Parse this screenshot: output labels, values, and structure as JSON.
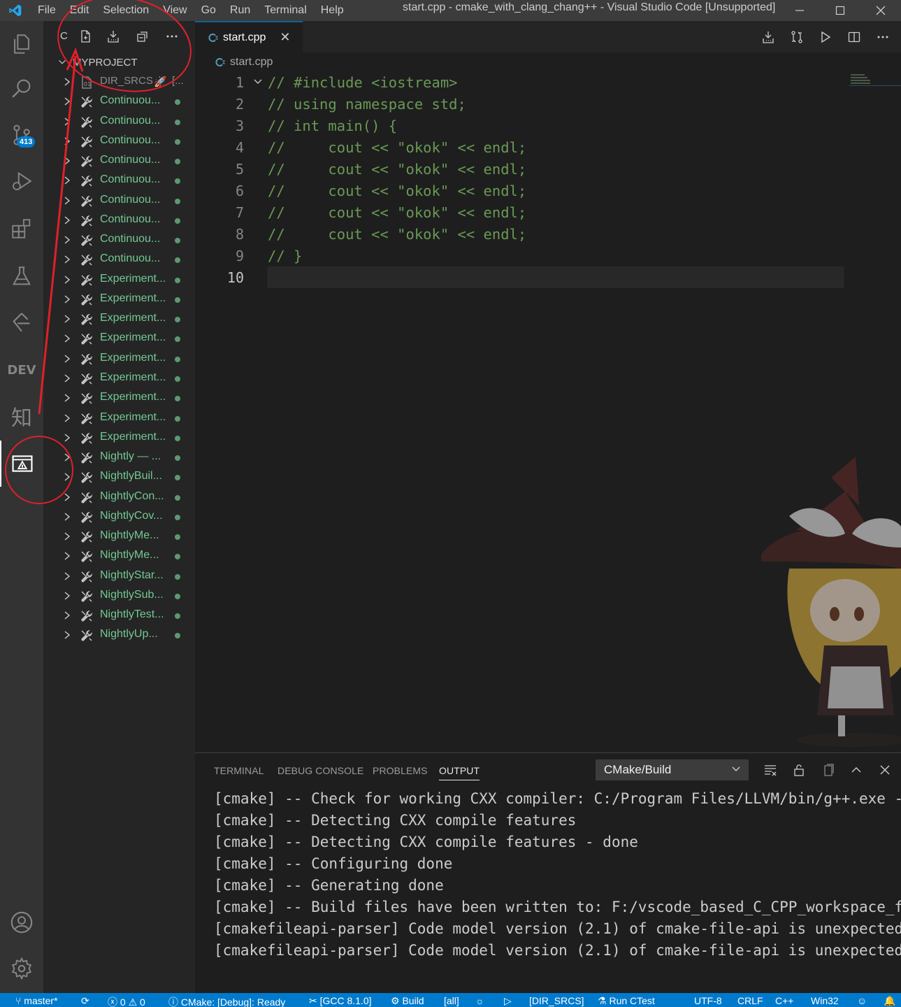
{
  "window": {
    "title": "start.cpp - cmake_with_clang_chang++ - Visual Studio Code [Unsupported]",
    "menu": [
      "File",
      "Edit",
      "Selection",
      "View",
      "Go",
      "Run",
      "Terminal",
      "Help"
    ],
    "controls": [
      "minimize-icon",
      "maximize-icon",
      "close-icon"
    ]
  },
  "activity_bar": {
    "items": [
      {
        "name": "explorer",
        "icon": "files-icon"
      },
      {
        "name": "search",
        "icon": "search-icon"
      },
      {
        "name": "source-control",
        "icon": "source-control-icon",
        "badge": "413"
      },
      {
        "name": "run-debug",
        "icon": "run-debug-icon"
      },
      {
        "name": "extensions",
        "icon": "extensions-icon"
      },
      {
        "name": "testing",
        "icon": "flask-icon"
      },
      {
        "name": "gitlens",
        "icon": "git-branch-icon"
      },
      {
        "name": "dev",
        "label": "DEV"
      },
      {
        "name": "zhihu",
        "label": "知"
      },
      {
        "name": "cmake",
        "icon": "cmake-icon",
        "active": true
      }
    ],
    "bottom": [
      {
        "name": "accounts",
        "icon": "account-icon"
      },
      {
        "name": "manage",
        "icon": "gear-icon"
      }
    ]
  },
  "sidebar": {
    "title_initial": "C",
    "toolbar_icons": [
      "new-file-icon",
      "build-icon",
      "collapse-all-icon",
      "more-actions-icon"
    ],
    "project": "MYPROJECT",
    "first_item": {
      "label": "DIR_SRCS",
      "extra": "[..."
    },
    "targets": [
      "Continuou...",
      "Continuou...",
      "Continuou...",
      "Continuou...",
      "Continuou...",
      "Continuou...",
      "Continuou...",
      "Continuou...",
      "Continuou...",
      "Experiment...",
      "Experiment...",
      "Experiment...",
      "Experiment...",
      "Experiment...",
      "Experiment...",
      "Experiment...",
      "Experiment...",
      "Experiment...",
      "Nightly — ...",
      "NightlyBuil...",
      "NightlyCon...",
      "NightlyCov...",
      "NightlyMe...",
      "NightlyMe...",
      "NightlyStar...",
      "NightlySub...",
      "NightlyTest...",
      "NightlyUp..."
    ]
  },
  "editor": {
    "tab_label": "start.cpp",
    "breadcrumb": "start.cpp",
    "lines": [
      "// #include <iostream>",
      "// using namespace std;",
      "// int main() {",
      "//     cout << \"okok\" << endl;",
      "//     cout << \"okok\" << endl;",
      "//     cout << \"okok\" << endl;",
      "//     cout << \"okok\" << endl;",
      "//     cout << \"okok\" << endl;",
      "// }",
      ""
    ],
    "line_numbers": [
      "1",
      "2",
      "3",
      "4",
      "5",
      "6",
      "7",
      "8",
      "9",
      "10"
    ],
    "current_line": 10,
    "actions": [
      "build-icon",
      "compare-icon",
      "run-icon",
      "split-editor-icon",
      "more-actions-icon"
    ]
  },
  "panel": {
    "tabs": [
      "TERMINAL",
      "DEBUG CONSOLE",
      "PROBLEMS",
      "OUTPUT"
    ],
    "active_tab": "OUTPUT",
    "channel": "CMake/Build",
    "actions": [
      "clear-output-icon",
      "lock-icon",
      "open-in-editor-icon",
      "maximize-panel-icon",
      "close-panel-icon"
    ],
    "output_lines": [
      "[cmake] -- Check for working CXX compiler: C:/Program Files/LLVM/bin/g++.exe -",
      "[cmake] -- Detecting CXX compile features",
      "[cmake] -- Detecting CXX compile features - done",
      "[cmake] -- Configuring done",
      "[cmake] -- Generating done",
      "[cmake] -- Build files have been written to: F:/vscode_based_C_CPP_workspace_f",
      "[cmakefileapi-parser] Code model version (2.1) of cmake-file-api is unexpected",
      "[cmakefileapi-parser] Code model version (2.1) of cmake-file-api is unexpected"
    ]
  },
  "status_bar": {
    "branch": "master*",
    "errors": "0",
    "warnings": "0",
    "cmake_status": "CMake: [Debug]: Ready",
    "kit": "[GCC 8.1.0]",
    "build": "Build",
    "target": "[all]",
    "launch_target": "[DIR_SRCS]",
    "ctest": "Run CTest",
    "encoding": "UTF-8",
    "eol": "CRLF",
    "language": "C++",
    "platform": "Win32"
  },
  "colors": {
    "accent": "#007acc",
    "modified_green": "#73c991",
    "comment": "#6a9955",
    "annotation_red": "#e0202a"
  }
}
